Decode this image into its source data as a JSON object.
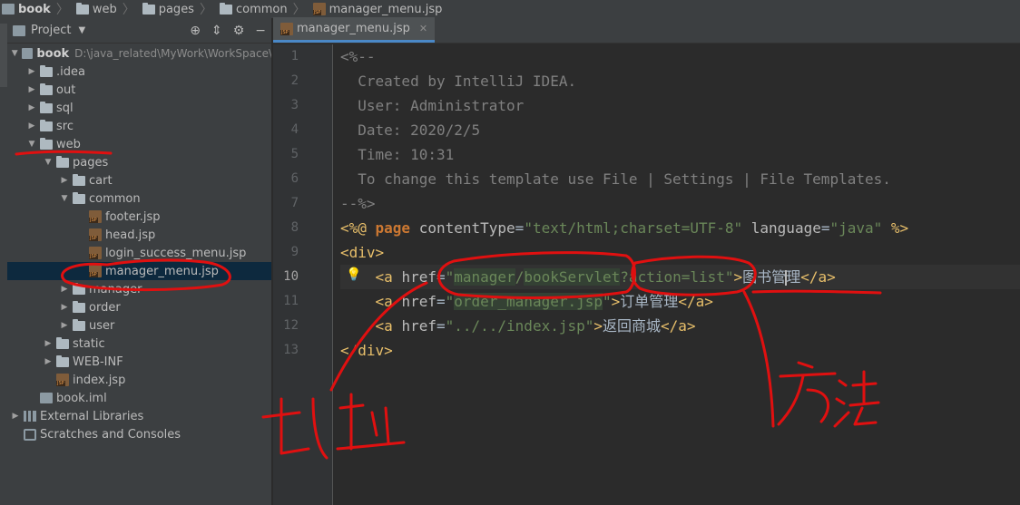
{
  "breadcrumb": [
    "book",
    "web",
    "pages",
    "common",
    "manager_menu.jsp"
  ],
  "project_panel": {
    "title": "Project",
    "tree": [
      {
        "label": "book",
        "path": "D:\\java_related\\MyWork\\WorkSpace\\",
        "depth": 0,
        "type": "module",
        "expanded": true
      },
      {
        "label": ".idea",
        "depth": 1,
        "type": "folder",
        "expanded": false
      },
      {
        "label": "out",
        "depth": 1,
        "type": "folder",
        "expanded": false
      },
      {
        "label": "sql",
        "depth": 1,
        "type": "folder",
        "expanded": false
      },
      {
        "label": "src",
        "depth": 1,
        "type": "folder",
        "expanded": false
      },
      {
        "label": "web",
        "depth": 1,
        "type": "folder",
        "expanded": true
      },
      {
        "label": "pages",
        "depth": 2,
        "type": "folder",
        "expanded": true
      },
      {
        "label": "cart",
        "depth": 3,
        "type": "folder",
        "expanded": false
      },
      {
        "label": "common",
        "depth": 3,
        "type": "folder",
        "expanded": true
      },
      {
        "label": "footer.jsp",
        "depth": 4,
        "type": "jsp"
      },
      {
        "label": "head.jsp",
        "depth": 4,
        "type": "jsp"
      },
      {
        "label": "login_success_menu.jsp",
        "depth": 4,
        "type": "jsp"
      },
      {
        "label": "manager_menu.jsp",
        "depth": 4,
        "type": "jsp",
        "selected": true
      },
      {
        "label": "manager",
        "depth": 3,
        "type": "folder",
        "expanded": false
      },
      {
        "label": "order",
        "depth": 3,
        "type": "folder",
        "expanded": false
      },
      {
        "label": "user",
        "depth": 3,
        "type": "folder",
        "expanded": false
      },
      {
        "label": "static",
        "depth": 2,
        "type": "folder",
        "expanded": false
      },
      {
        "label": "WEB-INF",
        "depth": 2,
        "type": "folder",
        "expanded": false
      },
      {
        "label": "index.jsp",
        "depth": 2,
        "type": "jsp"
      },
      {
        "label": "book.iml",
        "depth": 1,
        "type": "iml"
      },
      {
        "label": "External Libraries",
        "depth": 0,
        "type": "lib",
        "expanded": false
      },
      {
        "label": "Scratches and Consoles",
        "depth": 0,
        "type": "scratch"
      }
    ]
  },
  "editor": {
    "tab_label": "manager_menu.jsp",
    "current_line": 10,
    "lines": [
      [
        {
          "c": "cm",
          "t": "<%--"
        }
      ],
      [
        {
          "c": "cm",
          "t": "  Created by IntelliJ IDEA."
        }
      ],
      [
        {
          "c": "cm",
          "t": "  User: Administrator"
        }
      ],
      [
        {
          "c": "cm",
          "t": "  Date: 2020/2/5"
        }
      ],
      [
        {
          "c": "cm",
          "t": "  Time: 10:31"
        }
      ],
      [
        {
          "c": "cm",
          "t": "  To change this template use File | Settings | File Templates."
        }
      ],
      [
        {
          "c": "cm",
          "t": "--%>"
        }
      ],
      [
        {
          "c": "tag",
          "t": "<%@ "
        },
        {
          "c": "dir",
          "t": "page "
        },
        {
          "c": "attr",
          "t": "contentType"
        },
        {
          "c": "punc",
          "t": "="
        },
        {
          "c": "str",
          "t": "\"text/html;charset=UTF-8\""
        },
        {
          "c": "attr",
          "t": " language"
        },
        {
          "c": "punc",
          "t": "="
        },
        {
          "c": "str",
          "t": "\"java\""
        },
        {
          "c": "tag",
          "t": " %>"
        }
      ],
      [
        {
          "c": "tag",
          "t": "<div>"
        }
      ],
      [
        {
          "c": "txt",
          "t": "    "
        },
        {
          "c": "tag",
          "t": "<a "
        },
        {
          "c": "attr",
          "t": "href"
        },
        {
          "c": "punc",
          "t": "="
        },
        {
          "c": "str",
          "t": "\""
        },
        {
          "c": "str hl",
          "t": "manager"
        },
        {
          "c": "str",
          "t": "/"
        },
        {
          "c": "str hl",
          "t": "bookServlet"
        },
        {
          "c": "str",
          "t": "?action=list\""
        },
        {
          "c": "tag",
          "t": ">"
        },
        {
          "c": "txt",
          "t": "图书管"
        },
        {
          "c": "caret",
          "t": ""
        },
        {
          "c": "txt",
          "t": "理"
        },
        {
          "c": "tag",
          "t": "</a>"
        }
      ],
      [
        {
          "c": "txt",
          "t": "    "
        },
        {
          "c": "tag",
          "t": "<a "
        },
        {
          "c": "attr",
          "t": "href"
        },
        {
          "c": "punc",
          "t": "="
        },
        {
          "c": "str",
          "t": "\""
        },
        {
          "c": "str hl",
          "t": "order_manager.jsp"
        },
        {
          "c": "str",
          "t": "\""
        },
        {
          "c": "tag",
          "t": ">"
        },
        {
          "c": "txt",
          "t": "订单管理"
        },
        {
          "c": "tag",
          "t": "</a>"
        }
      ],
      [
        {
          "c": "txt",
          "t": "    "
        },
        {
          "c": "tag",
          "t": "<a "
        },
        {
          "c": "attr",
          "t": "href"
        },
        {
          "c": "punc",
          "t": "="
        },
        {
          "c": "str",
          "t": "\"../../index.jsp\""
        },
        {
          "c": "tag",
          "t": ">"
        },
        {
          "c": "txt",
          "t": "返回商城"
        },
        {
          "c": "tag",
          "t": "</a>"
        }
      ],
      [
        {
          "c": "tag",
          "t": "</div>"
        }
      ]
    ]
  },
  "annotations": {
    "ink_color": "#e01010",
    "label_address": "地址",
    "label_method": "方法"
  }
}
